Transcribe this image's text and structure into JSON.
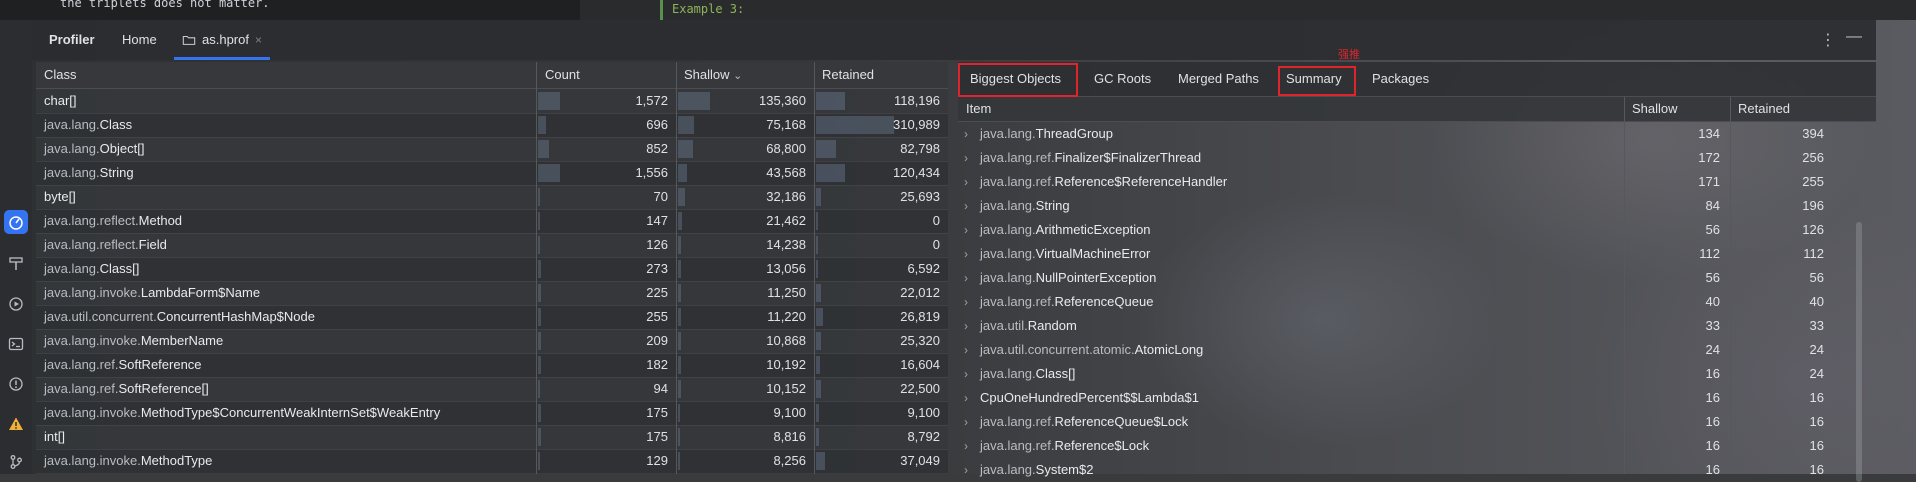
{
  "editor": {
    "code_line": "the triplets does not matter.",
    "example_label": "Example 3:"
  },
  "toolbar_icons": [
    "profiler-icon",
    "build-icon",
    "run-icon",
    "terminal-icon",
    "problems-icon",
    "warning-icon",
    "git-icon"
  ],
  "tabs": {
    "profiler": "Profiler",
    "home": "Home",
    "file": "as.hprof",
    "close": "×",
    "menu": "⋮",
    "minimize": "—"
  },
  "class_table": {
    "headers": {
      "class": "Class",
      "count": "Count",
      "shallow": "Shallow",
      "retained": "Retained"
    },
    "sort_indicator": "⌄",
    "rows": [
      {
        "pkg": "",
        "name": "char[]",
        "count": "1,572",
        "shallow": "135,360",
        "retained": "118,196",
        "count_frac": 0.16,
        "shallow_frac": 0.24,
        "retained_frac": 0.22
      },
      {
        "pkg": "java.lang.",
        "name": "Class",
        "count": "696",
        "shallow": "75,168",
        "retained": "310,989",
        "count_frac": 0.06,
        "shallow_frac": 0.12,
        "retained_frac": 0.6
      },
      {
        "pkg": "java.lang.",
        "name": "Object[]",
        "count": "852",
        "shallow": "68,800",
        "retained": "82,798",
        "count_frac": 0.08,
        "shallow_frac": 0.11,
        "retained_frac": 0.15
      },
      {
        "pkg": "java.lang.",
        "name": "String",
        "count": "1,556",
        "shallow": "43,568",
        "retained": "120,434",
        "count_frac": 0.16,
        "shallow_frac": 0.07,
        "retained_frac": 0.22
      },
      {
        "pkg": "",
        "name": "byte[]",
        "count": "70",
        "shallow": "32,186",
        "retained": "25,693",
        "count_frac": 0.01,
        "shallow_frac": 0.05,
        "retained_frac": 0.04
      },
      {
        "pkg": "java.lang.reflect.",
        "name": "Method",
        "count": "147",
        "shallow": "21,462",
        "retained": "0",
        "count_frac": 0.01,
        "shallow_frac": 0.03,
        "retained_frac": 0.0
      },
      {
        "pkg": "java.lang.reflect.",
        "name": "Field",
        "count": "126",
        "shallow": "14,238",
        "retained": "0",
        "count_frac": 0.01,
        "shallow_frac": 0.02,
        "retained_frac": 0.0
      },
      {
        "pkg": "java.lang.",
        "name": "Class[]",
        "count": "273",
        "shallow": "13,056",
        "retained": "6,592",
        "count_frac": 0.02,
        "shallow_frac": 0.02,
        "retained_frac": 0.01
      },
      {
        "pkg": "java.lang.invoke.",
        "name": "LambdaForm$Name",
        "count": "225",
        "shallow": "11,250",
        "retained": "22,012",
        "count_frac": 0.02,
        "shallow_frac": 0.02,
        "retained_frac": 0.04
      },
      {
        "pkg": "java.util.concurrent.",
        "name": "ConcurrentHashMap$Node",
        "count": "255",
        "shallow": "11,220",
        "retained": "26,819",
        "count_frac": 0.02,
        "shallow_frac": 0.02,
        "retained_frac": 0.05
      },
      {
        "pkg": "java.lang.invoke.",
        "name": "MemberName",
        "count": "209",
        "shallow": "10,868",
        "retained": "25,320",
        "count_frac": 0.02,
        "shallow_frac": 0.02,
        "retained_frac": 0.04
      },
      {
        "pkg": "java.lang.ref.",
        "name": "SoftReference",
        "count": "182",
        "shallow": "10,192",
        "retained": "16,604",
        "count_frac": 0.02,
        "shallow_frac": 0.02,
        "retained_frac": 0.03
      },
      {
        "pkg": "java.lang.ref.",
        "name": "SoftReference[]",
        "count": "94",
        "shallow": "10,152",
        "retained": "22,500",
        "count_frac": 0.01,
        "shallow_frac": 0.02,
        "retained_frac": 0.04
      },
      {
        "pkg": "java.lang.invoke.",
        "name": "MethodType$ConcurrentWeakInternSet$WeakEntry",
        "count": "175",
        "shallow": "9,100",
        "retained": "9,100",
        "count_frac": 0.02,
        "shallow_frac": 0.01,
        "retained_frac": 0.02
      },
      {
        "pkg": "",
        "name": "int[]",
        "count": "175",
        "shallow": "8,816",
        "retained": "8,792",
        "count_frac": 0.02,
        "shallow_frac": 0.01,
        "retained_frac": 0.02
      },
      {
        "pkg": "java.lang.invoke.",
        "name": "MethodType",
        "count": "129",
        "shallow": "8,256",
        "retained": "37,049",
        "count_frac": 0.01,
        "shallow_frac": 0.01,
        "retained_frac": 0.07
      }
    ]
  },
  "detail": {
    "tabs": [
      "Biggest Objects",
      "GC Roots",
      "Merged Paths",
      "Summary",
      "Packages"
    ],
    "annotation": "强推",
    "headers": {
      "item": "Item",
      "shallow": "Shallow",
      "retained": "Retained"
    },
    "rows": [
      {
        "pkg": "java.lang.",
        "name": "ThreadGroup",
        "shallow": "134",
        "retained": "394"
      },
      {
        "pkg": "java.lang.ref.",
        "name": "Finalizer$FinalizerThread",
        "shallow": "172",
        "retained": "256"
      },
      {
        "pkg": "java.lang.ref.",
        "name": "Reference$ReferenceHandler",
        "shallow": "171",
        "retained": "255"
      },
      {
        "pkg": "java.lang.",
        "name": "String",
        "shallow": "84",
        "retained": "196"
      },
      {
        "pkg": "java.lang.",
        "name": "ArithmeticException",
        "shallow": "56",
        "retained": "126"
      },
      {
        "pkg": "java.lang.",
        "name": "VirtualMachineError",
        "shallow": "112",
        "retained": "112"
      },
      {
        "pkg": "java.lang.",
        "name": "NullPointerException",
        "shallow": "56",
        "retained": "56"
      },
      {
        "pkg": "java.lang.ref.",
        "name": "ReferenceQueue",
        "shallow": "40",
        "retained": "40"
      },
      {
        "pkg": "java.util.",
        "name": "Random",
        "shallow": "33",
        "retained": "33"
      },
      {
        "pkg": "java.util.concurrent.atomic.",
        "name": "AtomicLong",
        "shallow": "24",
        "retained": "24"
      },
      {
        "pkg": "java.lang.",
        "name": "Class[]",
        "shallow": "16",
        "retained": "24"
      },
      {
        "pkg": "",
        "name": "CpuOneHundredPercent$$Lambda$1",
        "shallow": "16",
        "retained": "16"
      },
      {
        "pkg": "java.lang.ref.",
        "name": "ReferenceQueue$Lock",
        "shallow": "16",
        "retained": "16"
      },
      {
        "pkg": "java.lang.ref.",
        "name": "Reference$Lock",
        "shallow": "16",
        "retained": "16"
      },
      {
        "pkg": "java.lang.",
        "name": "System$2",
        "shallow": "16",
        "retained": "16"
      }
    ]
  },
  "colors": {
    "accent": "#3574f0",
    "highlight": "#e0242b",
    "example_green": "#8fb35a"
  }
}
